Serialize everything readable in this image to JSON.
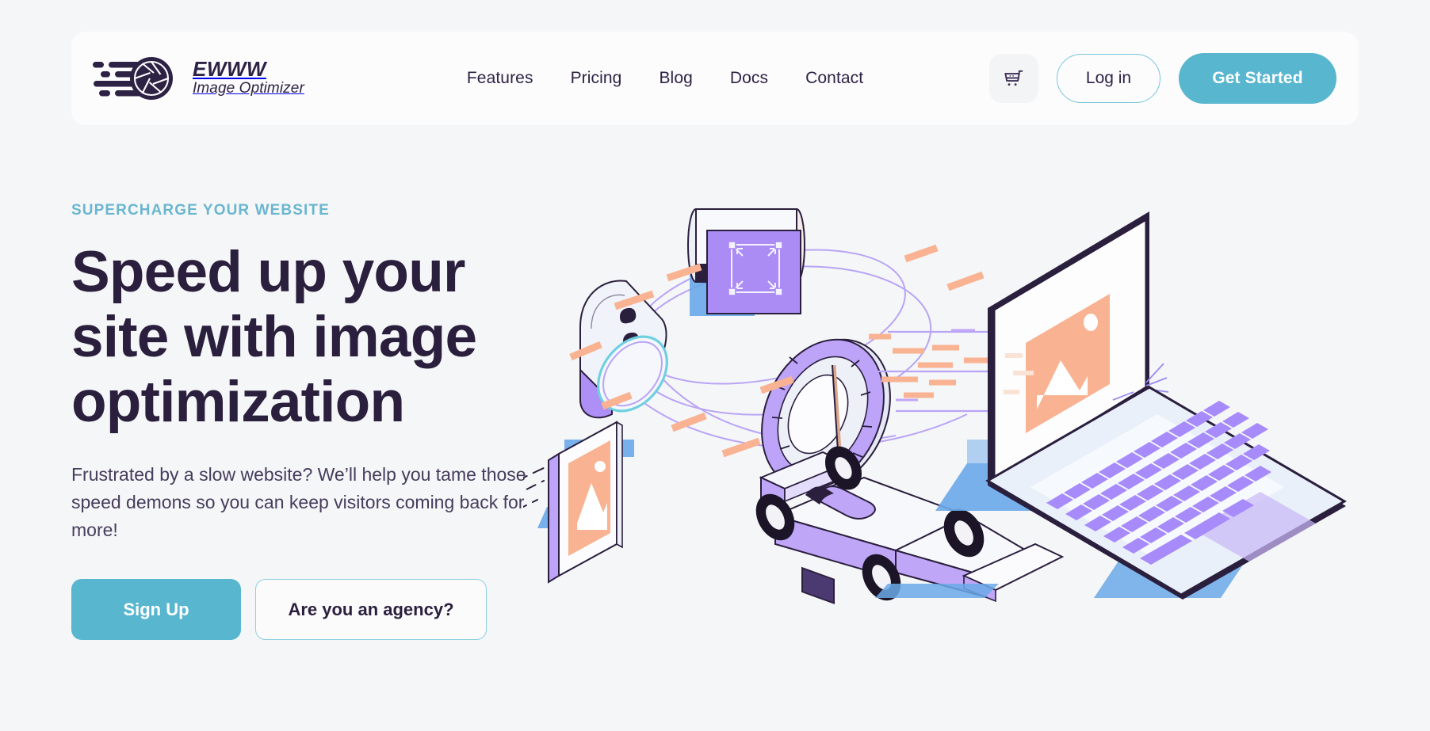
{
  "header": {
    "brand": {
      "name": "EWWW",
      "subtitle": "Image Optimizer",
      "logo_icon": "camera-aperture-speed-icon"
    },
    "nav": [
      {
        "label": "Features"
      },
      {
        "label": "Pricing"
      },
      {
        "label": "Blog"
      },
      {
        "label": "Docs"
      },
      {
        "label": "Contact"
      }
    ],
    "cart_icon": "shopping-cart-icon",
    "login_label": "Log in",
    "get_started_label": "Get Started"
  },
  "hero": {
    "eyebrow": "SUPERCHARGE YOUR WEBSITE",
    "headline": "Speed up your site with image optimization",
    "subhead": "Frustrated by a slow website? We’ll help you tame those speed demons so you can keep visitors coming back for more!",
    "primary_cta": "Sign Up",
    "secondary_cta": "Are you an agency?",
    "illustration_name": "isometric-image-optimization-illustration",
    "illustration_elements": [
      "laptop-with-image-placeholder",
      "race-car",
      "framed-picture",
      "crop-resize-tool",
      "speedometer-dial",
      "gauge-ring",
      "orbit-rings",
      "speed-lines"
    ]
  },
  "colors": {
    "page_background": "#f5f6f8",
    "card_background": "#fcfcfd",
    "accent_teal": "#58b6cf",
    "eyebrow_teal": "#6ab6cf",
    "text_dark": "#2b1f3e",
    "text_body": "#463c5c",
    "illustration_purple": "#a78bfa",
    "illustration_peach": "#f8b08a",
    "illustration_blue": "#6aa9e9"
  }
}
